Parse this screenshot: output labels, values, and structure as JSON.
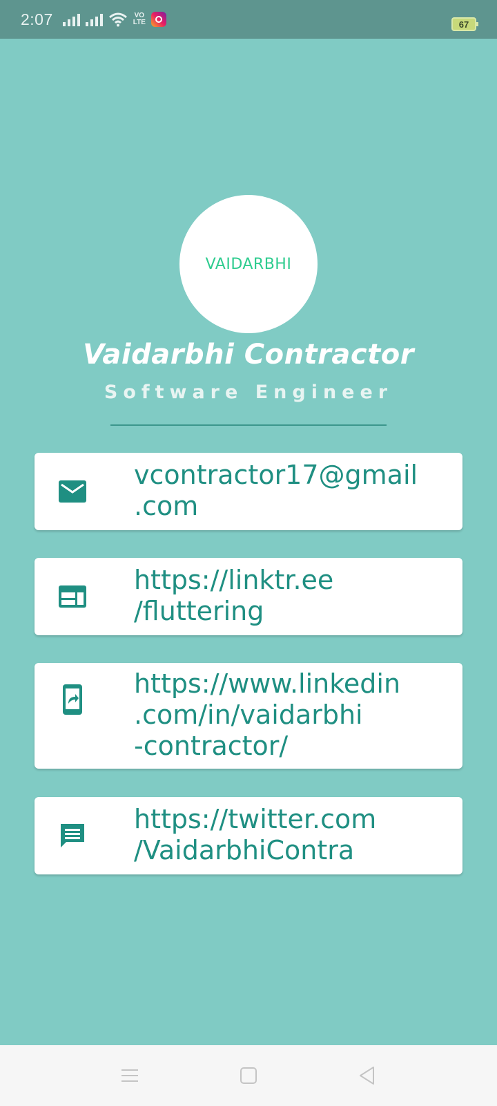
{
  "status_bar": {
    "time": "2:07",
    "volte_top": "VO",
    "volte_bottom": "LTE",
    "battery": "67"
  },
  "profile": {
    "avatar_text": "VAIDARBHI",
    "name": "Vaidarbhi Contractor",
    "title": "Software Engineer"
  },
  "contacts": [
    {
      "icon": "email-icon",
      "lines": [
        "vcontractor17@gmail",
        ".com"
      ]
    },
    {
      "icon": "web-icon",
      "lines": [
        "https://linktr.ee",
        "/fluttering"
      ]
    },
    {
      "icon": "phone-forward-icon",
      "lines": [
        "https://www.linkedin",
        ".com/in/vaidarbhi",
        "-contractor/"
      ]
    },
    {
      "icon": "message-icon",
      "lines": [
        "https://twitter.com",
        "/VaidarbhiContra"
      ]
    }
  ],
  "colors": {
    "background": "#80cbc4",
    "accent": "#1f8f82",
    "status_bar": "#5e958f"
  }
}
